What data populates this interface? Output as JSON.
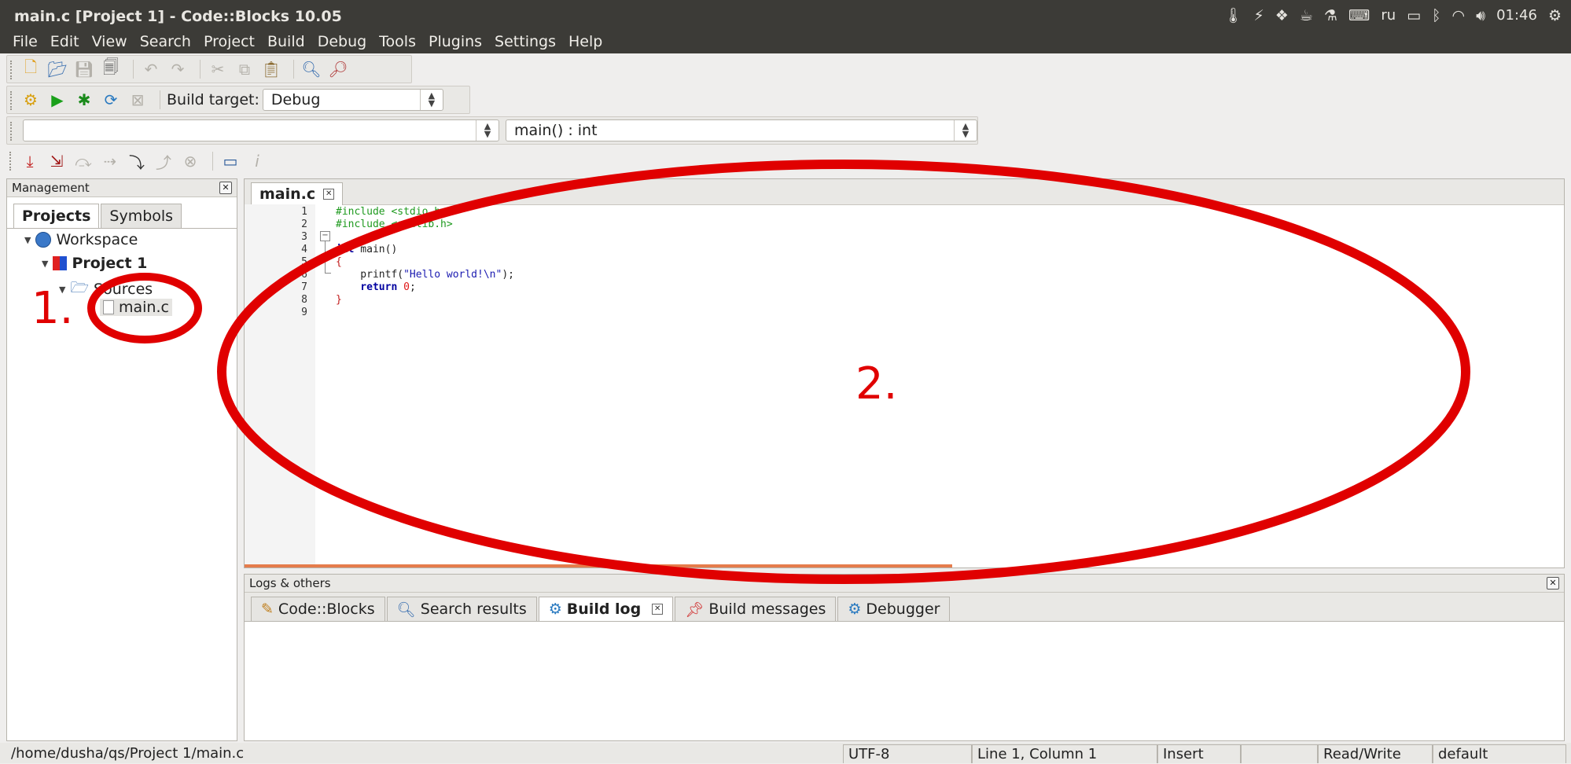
{
  "window": {
    "title": "main.c [Project 1] - Code::Blocks 10.05"
  },
  "tray": {
    "icons": [
      "temperature-icon",
      "power-icon",
      "dropbox-icon",
      "cup-icon",
      "flask-icon",
      "keyboard-icon",
      "battery-icon",
      "bluetooth-icon",
      "wifi-icon",
      "volume-icon",
      "settings-gear-icon"
    ],
    "keyboard_layout": "ru",
    "clock": "01:46"
  },
  "menubar": [
    "File",
    "Edit",
    "View",
    "Search",
    "Project",
    "Build",
    "Debug",
    "Tools",
    "Plugins",
    "Settings",
    "Help"
  ],
  "toolbar_build": {
    "target_label": "Build target:",
    "target_value": "Debug"
  },
  "code_toolbar": {
    "scope_value": "",
    "function_value": "main() : int"
  },
  "management": {
    "title": "Management",
    "tabs": [
      "Projects",
      "Symbols"
    ],
    "tree": {
      "workspace": "Workspace",
      "project": "Project 1",
      "folder": "Sources",
      "file": "main.c"
    }
  },
  "editor": {
    "tab": "main.c",
    "line_numbers": [
      "1",
      "2",
      "3",
      "4",
      "5",
      "6",
      "7",
      "8",
      "9"
    ],
    "code": {
      "l1": "#include <stdio.h>",
      "l2": "#include <stdlib.h>",
      "l4_kw": "int",
      "l4_rest": " main()",
      "l5": "{",
      "l6_fn": "    printf(",
      "l6_str": "\"Hello world!\\n\"",
      "l6_end": ");",
      "l7_kw": "    return",
      "l7_num": " 0",
      "l7_end": ";",
      "l8": "}"
    }
  },
  "logs": {
    "title": "Logs & others",
    "tabs": [
      "Code::Blocks",
      "Search results",
      "Build log",
      "Build messages",
      "Debugger"
    ]
  },
  "statusbar": {
    "path": "/home/dusha/qs/Project 1/main.c",
    "encoding": "UTF-8",
    "position": "Line 1, Column 1",
    "mode": "Insert",
    "empty": "",
    "access": "Read/Write",
    "profile": "default"
  },
  "annotations": {
    "label1": "1.",
    "label2": "2.",
    "color": "#e00000"
  }
}
